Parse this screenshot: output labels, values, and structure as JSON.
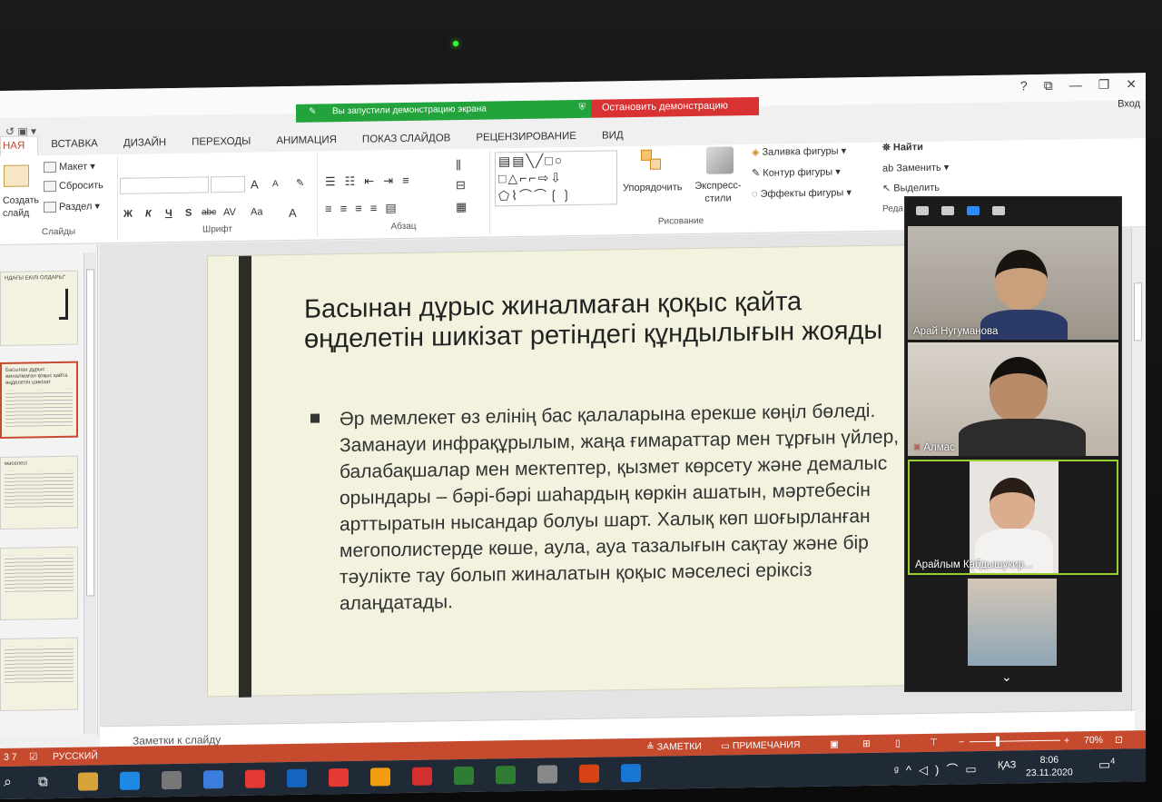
{
  "zoom_banner": {
    "sharing_message": "Вы запустили демонстрацию экрана",
    "stop_button": "Остановить демонстрацию"
  },
  "window": {
    "help": "?",
    "controls": [
      "?",
      "⧉",
      "—",
      "❐",
      "✕"
    ],
    "sign_in": "Вход"
  },
  "ribbon": {
    "tabs": [
      "НАЯ",
      "ВСТАВКА",
      "ДИЗАЙН",
      "ПЕРЕХОДЫ",
      "АНИМАЦИЯ",
      "ПОКАЗ СЛАЙДОВ",
      "РЕЦЕНЗИРОВАНИЕ",
      "ВИД"
    ],
    "slides_group": {
      "label": "Слайды",
      "create_slide": "Создать слайд",
      "layout": "Макет",
      "reset": "Сбросить",
      "section": "Раздел"
    },
    "font_group": {
      "label": "Шрифт",
      "bold": "Ж",
      "italic": "К",
      "underline": "Ч",
      "strike": "S",
      "abc": "abc",
      "spacing": "AV",
      "case": "Aa",
      "grow": "A",
      "shrink": "A"
    },
    "paragraph_group": {
      "label": "Абзац"
    },
    "drawing_group": {
      "label": "Рисование",
      "arrange": "Упорядочить",
      "quick_styles": "Экспресс-стили",
      "shape_fill": "Заливка фигуры",
      "shape_outline": "Контур фигуры",
      "shape_effects": "Эффекты фигуры"
    },
    "editing_group": {
      "label": "Реда",
      "find": "Найти",
      "replace": "Заменить",
      "select": "Выделить"
    }
  },
  "thumbnails": [
    {
      "text": "НДАҒЫ ЕКІЛІ ОЛДАРЫ\""
    },
    {
      "text": "Басынан дұрыс жиналмаған қоқыс қайта өңделетін шикізат"
    },
    {
      "text": "мәселесі"
    },
    {
      "text": ""
    },
    {
      "text": ""
    }
  ],
  "slide": {
    "title": "Басынан дұрыс жиналмаған қоқыс қайта өңделетін шикізат ретіндегі құндылығын жояды",
    "body": "Әр мемлекет өз елінің бас қалаларына ерекше көңіл бөледі. Заманауи инфрақұрылым, жаңа ғимараттар мен тұрғын үйлер, балабақшалар мен мектептер, қызмет көрсету және демалыс орындары – бәрі-бәрі шаһардың көркін ашатын, мәртебесін арттыратын нысандар болуы шарт. Халық көп шоғырланған мегополистерде көше, аула, ауа тазалығын сақтау және бір тәулікте тау болып жиналатын қоқыс мәселесі еріксіз алаңдатады."
  },
  "notes": {
    "placeholder": "Заметки к слайду"
  },
  "statusbar": {
    "slide_counter": "3 7",
    "language": "РУССКИЙ",
    "notes": "ЗАМЕТКИ",
    "comments": "ПРИМЕЧАНИЯ",
    "zoom": "70%",
    "zoom_level": 0.7,
    "minus": "−",
    "plus": "+"
  },
  "taskbar": {
    "lang": "ҚАЗ",
    "time": "8:06",
    "date": "23.11.2020",
    "notifications": "4",
    "app_colors": [
      "#d9a33b",
      "#1e88e5",
      "#777777",
      "#3b7ddd",
      "#e53935",
      "#1565c0",
      "#e53935",
      "#f39c12",
      "#d32f2f",
      "#2e7d32",
      "#2e7d32",
      "#888888",
      "#d84315",
      "#1976d2"
    ]
  },
  "zoom_gallery": {
    "participants": [
      {
        "name": "Арай Нугуманова",
        "muted": false
      },
      {
        "name": "Алмас",
        "muted": true
      },
      {
        "name": "Арайлым Кабдышукир...",
        "muted": false,
        "speaking": true
      },
      {
        "name": "",
        "muted": false
      }
    ],
    "active_view_color": "#2d8cff",
    "speaking_border_color": "#9acd32"
  }
}
